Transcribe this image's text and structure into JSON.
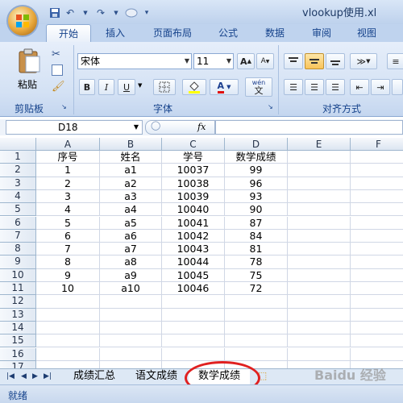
{
  "window": {
    "title": "vlookup使用.xl"
  },
  "ribbon_tabs": [
    {
      "label": "开始"
    },
    {
      "label": "插入"
    },
    {
      "label": "页面布局"
    },
    {
      "label": "公式"
    },
    {
      "label": "数据"
    },
    {
      "label": "审阅"
    },
    {
      "label": "视图"
    }
  ],
  "ribbon": {
    "paste_label": "粘贴",
    "clipboard_label": "剪贴板",
    "font_name": "宋体",
    "font_size": "11",
    "bold": "B",
    "italic": "I",
    "underline": "U",
    "font_color_glyph": "A",
    "font_group_label": "字体",
    "alignment_group_label": "对齐方式",
    "wen_glyph": "wén",
    "wen_char": "文"
  },
  "formula_bar": {
    "name_box": "D18",
    "fx": "fx",
    "formula": ""
  },
  "columns": [
    "A",
    "B",
    "C",
    "D",
    "E",
    "F"
  ],
  "rows": [
    "1",
    "2",
    "3",
    "4",
    "5",
    "6",
    "7",
    "8",
    "9",
    "10",
    "11",
    "12",
    "13",
    "14",
    "15",
    "16",
    "17"
  ],
  "table": {
    "headers": [
      "序号",
      "姓名",
      "学号",
      "数学成绩"
    ],
    "records": [
      [
        "1",
        "a1",
        "10037",
        "99"
      ],
      [
        "2",
        "a2",
        "10038",
        "96"
      ],
      [
        "3",
        "a3",
        "10039",
        "93"
      ],
      [
        "4",
        "a4",
        "10040",
        "90"
      ],
      [
        "5",
        "a5",
        "10041",
        "87"
      ],
      [
        "6",
        "a6",
        "10042",
        "84"
      ],
      [
        "7",
        "a7",
        "10043",
        "81"
      ],
      [
        "8",
        "a8",
        "10044",
        "78"
      ],
      [
        "9",
        "a9",
        "10045",
        "75"
      ],
      [
        "10",
        "a10",
        "10046",
        "72"
      ]
    ]
  },
  "sheet_tabs": [
    {
      "label": "成绩汇总"
    },
    {
      "label": "语文成绩"
    },
    {
      "label": "数学成绩",
      "active": true
    }
  ],
  "status": {
    "text": "就绪"
  },
  "watermark": "Baidu 经验",
  "colors": {
    "accent": "#15428b",
    "highlight_ring": "#e02020"
  }
}
